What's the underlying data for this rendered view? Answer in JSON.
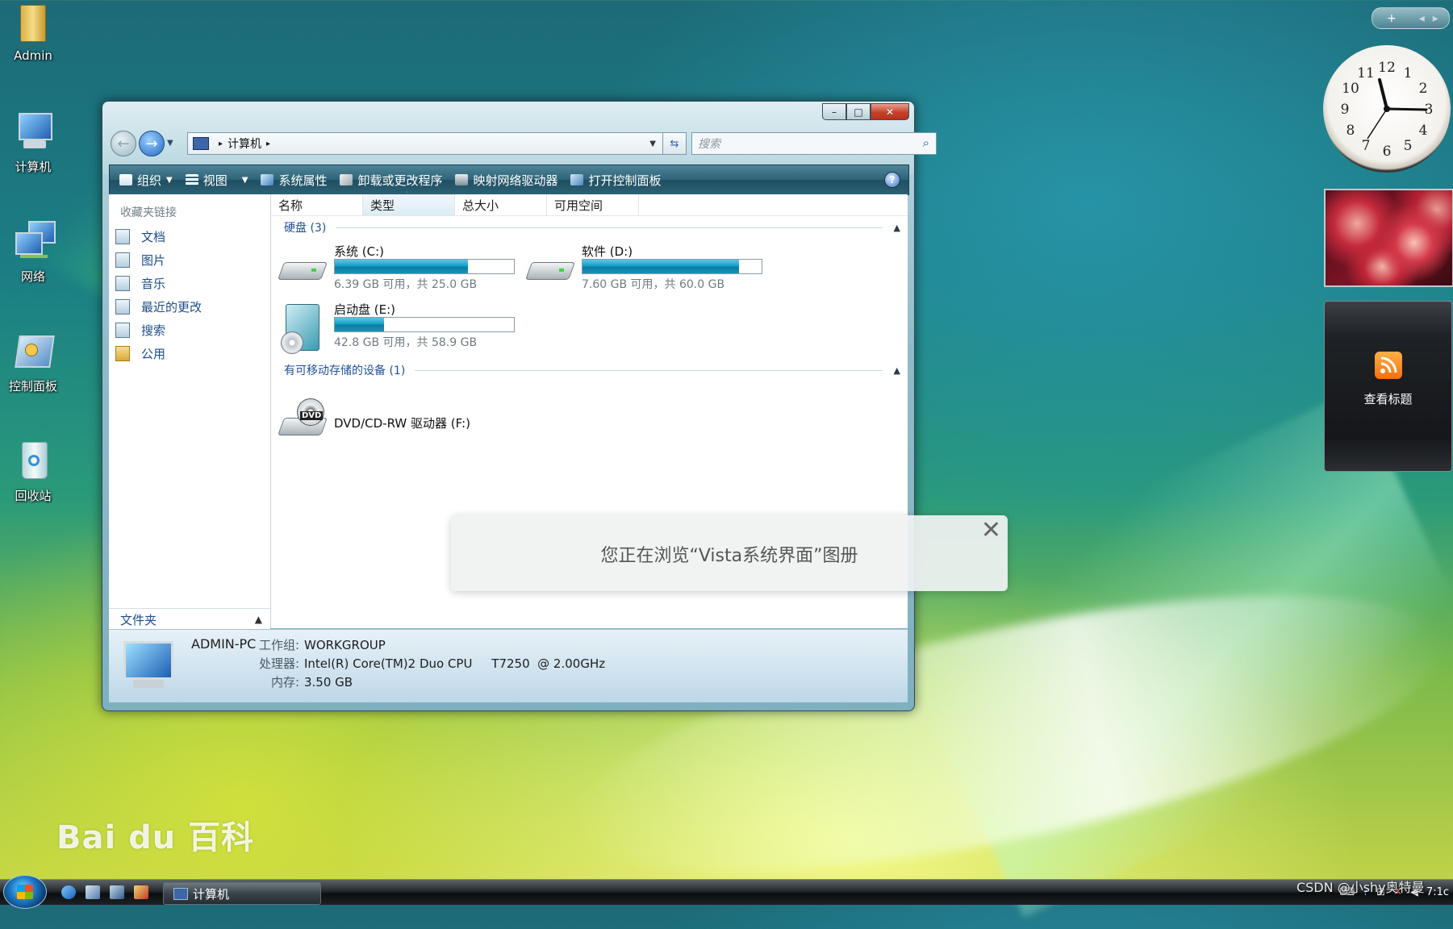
{
  "desktop": {
    "icons": [
      {
        "label": "Admin"
      },
      {
        "label": "计算机"
      },
      {
        "label": "网络"
      },
      {
        "label": "控制面板"
      },
      {
        "label": "回收站"
      }
    ]
  },
  "window": {
    "caption": {
      "minimize": "–",
      "maximize": "□",
      "close": "✕"
    },
    "address": {
      "crumb": "计算机",
      "sep": "▸"
    },
    "search": {
      "placeholder": "搜索"
    },
    "toolbar": {
      "organize": "组织",
      "views": "视图",
      "system_properties": "系统属性",
      "uninstall": "卸载或更改程序",
      "map_drive": "映射网络驱动器",
      "control_panel": "打开控制面板",
      "help": "?"
    },
    "nav_pane": {
      "title": "收藏夹链接",
      "items": [
        {
          "label": "文档"
        },
        {
          "label": "图片"
        },
        {
          "label": "音乐"
        },
        {
          "label": "最近的更改"
        },
        {
          "label": "搜索"
        },
        {
          "label": "公用"
        }
      ],
      "folders_label": "文件夹"
    },
    "columns": [
      "名称",
      "类型",
      "总大小",
      "可用空间"
    ],
    "groups": {
      "hard_disks": {
        "label": "硬盘 (3)",
        "drives": [
          {
            "name": "系统 (C:)",
            "info": "6.39 GB 可用，共 25.0 GB",
            "used_fraction": 0.744
          },
          {
            "name": "软件 (D:)",
            "info": "7.60 GB 可用，共 60.0 GB",
            "used_fraction": 0.873
          },
          {
            "name": "启动盘 (E:)",
            "info": "42.8 GB 可用，共 58.9 GB",
            "used_fraction": 0.273
          }
        ]
      },
      "removable": {
        "label": "有可移动存储的设备 (1)",
        "device": {
          "name": "DVD/CD-RW 驱动器 (F:)",
          "badge": "DVD"
        }
      }
    },
    "details": {
      "computer_name": "ADMIN-PC",
      "workgroup_key": "工作组:",
      "workgroup_val": "WORKGROUP",
      "cpu_key": "处理器:",
      "cpu_val": "Intel(R) Core(TM)2 Duo CPU     T7250  @ 2.00GHz",
      "mem_key": "内存:",
      "mem_val": "3.50 GB"
    }
  },
  "toast": {
    "message": "您正在浏览“Vista系统界面”图册",
    "close": "✕"
  },
  "gadgets": {
    "top_bar": {
      "add": "+",
      "prev": "◂",
      "next": "▸"
    },
    "clock_numbers": [
      "12",
      "1",
      "2",
      "3",
      "4",
      "5",
      "6",
      "7",
      "8",
      "9",
      "10",
      "11"
    ],
    "rss_label": "查看标题"
  },
  "taskbar": {
    "task_label": "计算机",
    "time": "7:1c"
  },
  "watermarks": {
    "baidu": "Bai du 百科",
    "csdn": "CSDN @小shy奥特曼"
  },
  "colors": {
    "accent": "#1e4f9a",
    "disk_fill": "#15a0c8",
    "toolbar": "#2e6377"
  }
}
